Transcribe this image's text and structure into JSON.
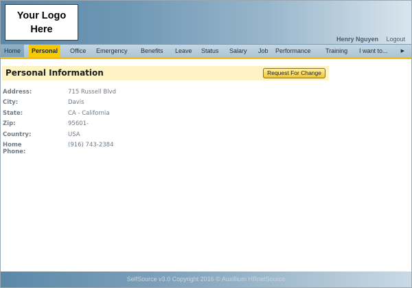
{
  "header": {
    "logo_text": "Your Logo Here",
    "user_name": "Henry Nguyen",
    "logout_label": "Logout"
  },
  "nav": {
    "items": [
      {
        "label": "Home"
      },
      {
        "label": "Personal"
      },
      {
        "label": "Office"
      },
      {
        "label": "Emergency"
      },
      {
        "label": "Benefits"
      },
      {
        "label": "Leave"
      },
      {
        "label": "Status"
      },
      {
        "label": "Salary"
      },
      {
        "label": "Job"
      },
      {
        "label": "Performance"
      },
      {
        "label": "Training"
      },
      {
        "label": "I want to..."
      }
    ],
    "active": "Personal",
    "arrow_icon": "arrow-right-icon"
  },
  "section": {
    "title": "Personal Information",
    "request_button": "Request For Change"
  },
  "fields": [
    {
      "label": "Address:",
      "value": "715 Russell Blvd"
    },
    {
      "label": "City:",
      "value": "Davis"
    },
    {
      "label": "State:",
      "value": "CA - California"
    },
    {
      "label": "Zip:",
      "value": "95601-"
    },
    {
      "label": "Country:",
      "value": "USA"
    },
    {
      "label": "Home Phone:",
      "value": "(916) 743-2384"
    }
  ],
  "footer": {
    "text": "SelfSource v3.0 Copyright 2016 © Auxillium HRnetSource"
  },
  "colors": {
    "nav_active": "#f6c900",
    "section_bg": "#fdf3c5",
    "header_blue": "#5b88a8"
  }
}
